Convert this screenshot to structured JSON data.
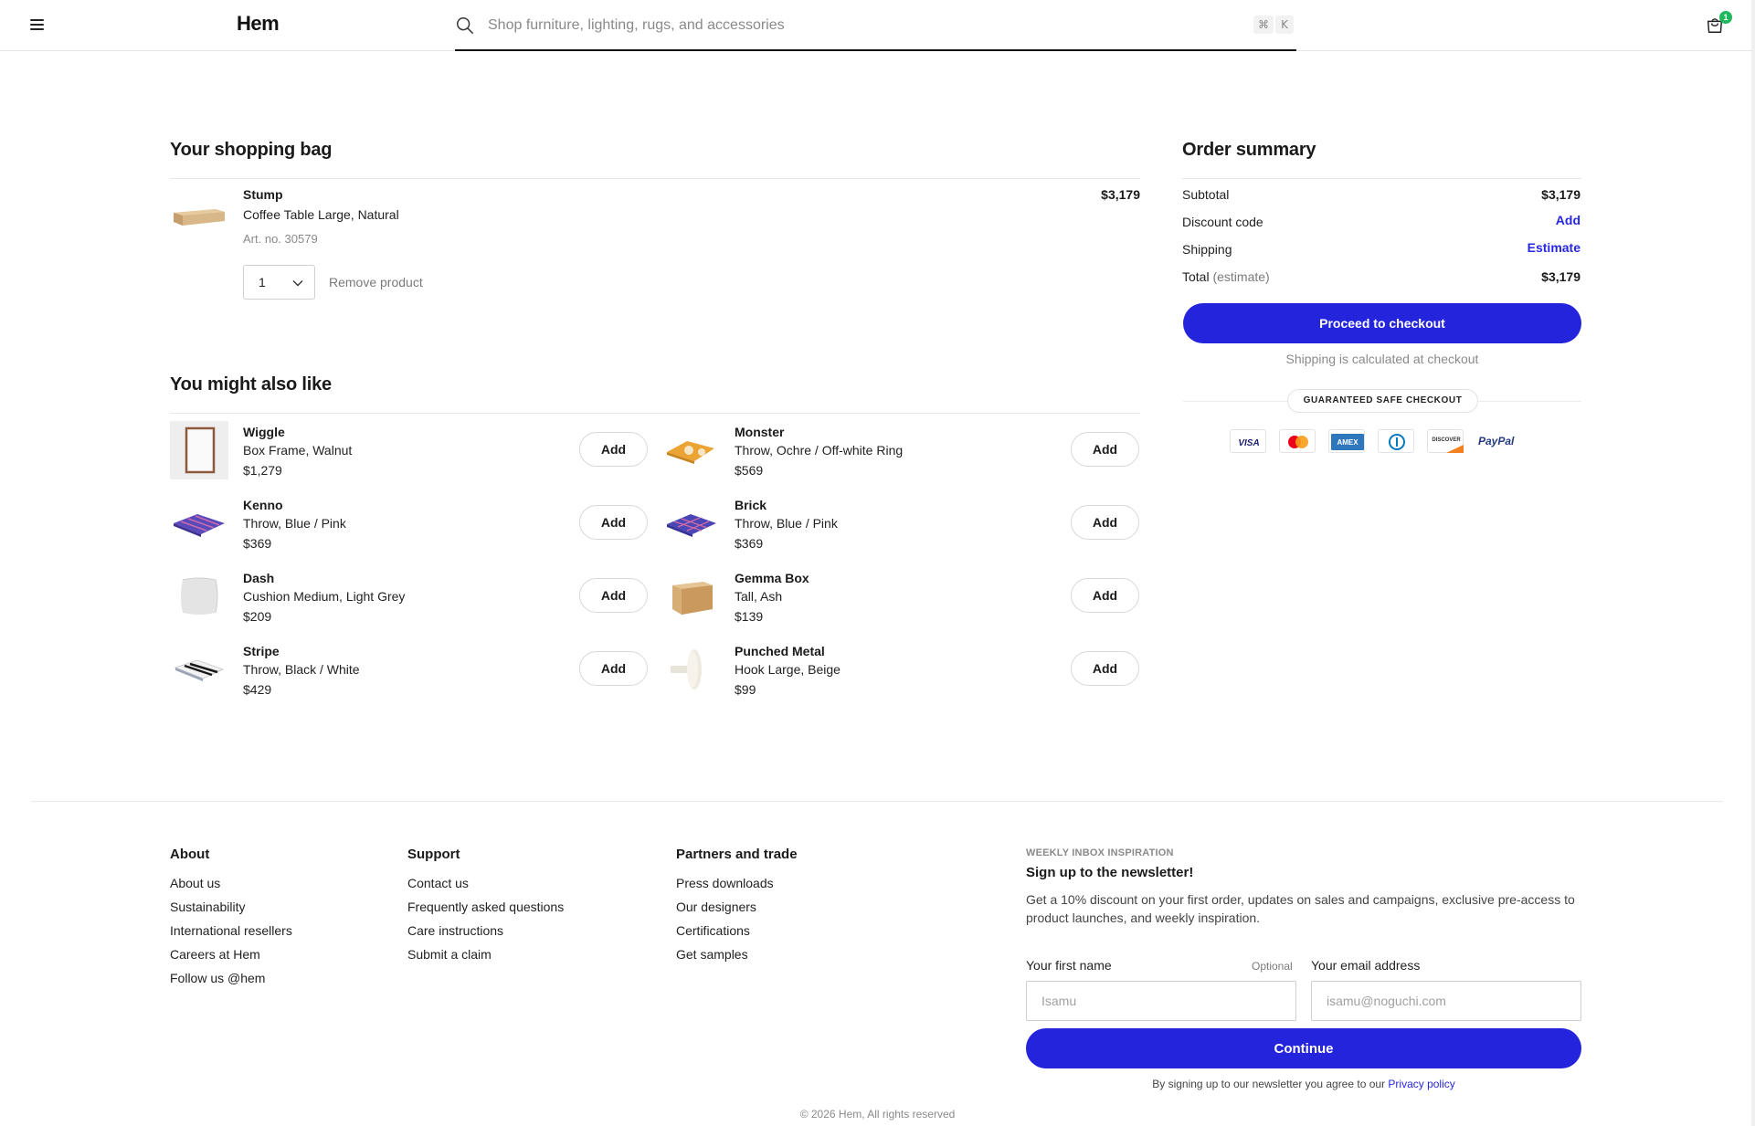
{
  "header": {
    "logo": "Hem",
    "search_placeholder": "Shop furniture, lighting, rugs, and accessories",
    "shortcut_cmd": "⌘",
    "shortcut_key": "K",
    "bag_count": "1"
  },
  "bag": {
    "title": "Your shopping bag",
    "item": {
      "name": "Stump",
      "description": "Coffee Table Large, Natural",
      "article": "Art. no. 30579",
      "price": "$3,179",
      "quantity": "1",
      "remove_label": "Remove product"
    }
  },
  "recommendations": {
    "title": "You might also like",
    "add_label": "Add",
    "items": [
      {
        "name": "Wiggle",
        "description": "Box Frame, Walnut",
        "price": "$1,279",
        "icon": "frame-icon"
      },
      {
        "name": "Monster",
        "description": "Throw, Ochre / Off-white Ring",
        "price": "$569",
        "icon": "throw-icon"
      },
      {
        "name": "Kenno",
        "description": "Throw, Blue / Pink",
        "price": "$369",
        "icon": "throw-icon"
      },
      {
        "name": "Brick",
        "description": "Throw, Blue / Pink",
        "price": "$369",
        "icon": "throw-icon"
      },
      {
        "name": "Dash",
        "description": "Cushion Medium, Light Grey",
        "price": "$209",
        "icon": "cushion-icon"
      },
      {
        "name": "Gemma Box",
        "description": "Tall, Ash",
        "price": "$139",
        "icon": "box-icon"
      },
      {
        "name": "Stripe",
        "description": "Throw, Black / White",
        "price": "$429",
        "icon": "throw-icon"
      },
      {
        "name": "Punched Metal",
        "description": "Hook Large, Beige",
        "price": "$99",
        "icon": "hook-icon"
      }
    ]
  },
  "summary": {
    "title": "Order summary",
    "subtotal_label": "Subtotal",
    "subtotal_value": "$3,179",
    "discount_label": "Discount code",
    "discount_action": "Add",
    "shipping_label": "Shipping",
    "shipping_action": "Estimate",
    "total_label": "Total",
    "total_qualifier": "(estimate)",
    "total_value": "$3,179",
    "checkout_label": "Proceed to checkout",
    "shipping_note": "Shipping is calculated at checkout",
    "safe_checkout": "GUARANTEED SAFE CHECKOUT",
    "payment_methods": [
      "visa-icon",
      "mastercard-icon",
      "amex-icon",
      "diners-club-icon",
      "discover-icon",
      "paypal-icon"
    ],
    "payment_text": {
      "visa": "VISA",
      "amex": "AMEX",
      "discover": "DISCOVER",
      "paypal": "PayPal"
    }
  },
  "footer": {
    "columns": [
      {
        "title": "About",
        "links": [
          "About us",
          "Sustainability",
          "International resellers",
          "Careers at Hem",
          "Follow us @hem"
        ]
      },
      {
        "title": "Support",
        "links": [
          "Contact us",
          "Frequently asked questions",
          "Care instructions",
          "Submit a claim"
        ]
      },
      {
        "title": "Partners and trade",
        "links": [
          "Press downloads",
          "Our designers",
          "Certifications",
          "Get samples"
        ]
      }
    ],
    "newsletter": {
      "kicker": "WEEKLY INBOX INSPIRATION",
      "title": "Sign up to the newsletter!",
      "body": "Get a 10% discount on your first order, updates on sales and campaigns, exclusive pre-access to product launches, and weekly inspiration.",
      "first_name_label": "Your first name",
      "optional_label": "Optional",
      "first_name_placeholder": "Isamu",
      "email_label": "Your email address",
      "email_placeholder": "isamu@noguchi.com",
      "continue_label": "Continue",
      "consent_text": "By signing up to our newsletter you agree to our",
      "privacy_link": "Privacy policy"
    },
    "copyright": "© 2026 Hem, All rights reserved"
  },
  "colors": {
    "accent": "#2424dc",
    "link": "#2727e0",
    "badge": "#1fb85c"
  }
}
